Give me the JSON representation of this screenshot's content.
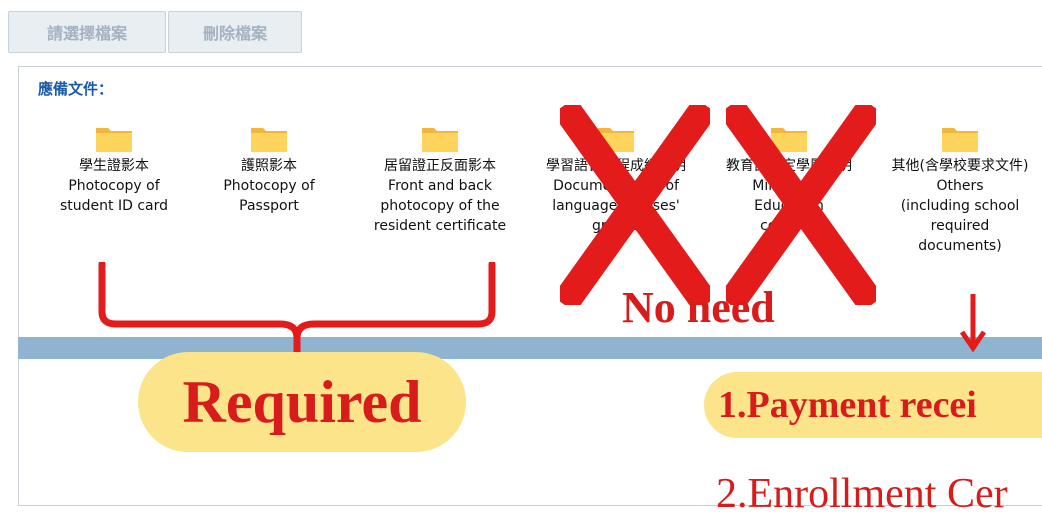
{
  "toolbar": {
    "select_file": "請選擇檔案",
    "delete_file": "刪除檔案"
  },
  "panel": {
    "title": "應備文件："
  },
  "documents": [
    {
      "zh": "學生證影本",
      "en": "Photocopy of student ID card"
    },
    {
      "zh": "護照影本",
      "en": "Photocopy of Passport"
    },
    {
      "zh": "居留證正反面影本",
      "en": "Front and back photocopy of the resident certificate"
    },
    {
      "zh": "學習語言課程成績證明",
      "en": "Documentation of language courses' grades"
    },
    {
      "zh": "教育部認定學歷證明",
      "en": "Ministry of Education certified"
    },
    {
      "zh": "其他(含學校要求文件) Others",
      "en": "(including school required documents)"
    }
  ],
  "annotations": {
    "no_need": "No need",
    "required": "Required",
    "payment": "1.Payment recei",
    "enrollment": "2.Enrollment Cer",
    "accent_color": "#d81b1b",
    "highlight_color": "#fbe48a"
  }
}
